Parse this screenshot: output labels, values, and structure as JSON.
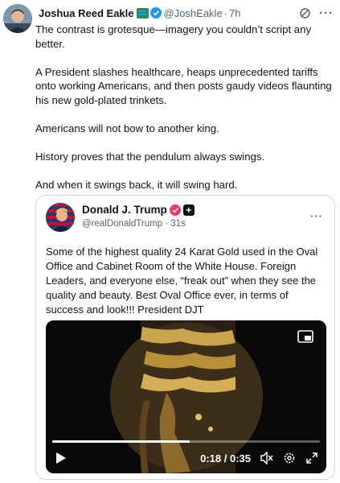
{
  "tweet": {
    "author_name": "Joshua Reed Eakle",
    "handle": "@JoshEakle",
    "separator": "·",
    "time": "7h",
    "more_label": "···",
    "paragraphs": [
      "The contrast is grotesque—imagery you couldn’t script any better.",
      "A President slashes healthcare, heaps unprecedented tariffs onto working Americans, and then posts gaudy videos flaunting his new gold-plated trinkets.",
      "Americans will not bow to another king.",
      "History proves that the pendulum always swings.",
      "And when it swings back, it will swing hard."
    ]
  },
  "quote": {
    "author_name": "Donald J. Trump",
    "handle": "@realDonaldTrump",
    "separator": "·",
    "time": "31s",
    "more_label": "···",
    "badge_square": "+",
    "text": "Some of the highest quality 24 Karat Gold used in the Oval Office and Cabinet Room of the White House. Foreign Leaders, and everyone else, “freak out” when they see the quality and beauty. Best Oval Office ever, in terms of success and look!!! President DJT",
    "video": {
      "time_readout": "0:18 / 0:35",
      "progress_fraction": 0.514
    }
  },
  "colors": {
    "secondary_text": "#536471",
    "verified_blue": "#1d9bf0",
    "quote_border": "#cfd9de",
    "gold": "#c9a44c"
  },
  "icons": {
    "header_grok": "grok-icon",
    "header_more": "more-icon",
    "verified": "verified-badge-icon",
    "pip": "picture-in-picture-icon",
    "play": "play-icon",
    "mute": "mute-icon",
    "settings": "settings-gear-icon",
    "fullscreen": "fullscreen-icon"
  }
}
